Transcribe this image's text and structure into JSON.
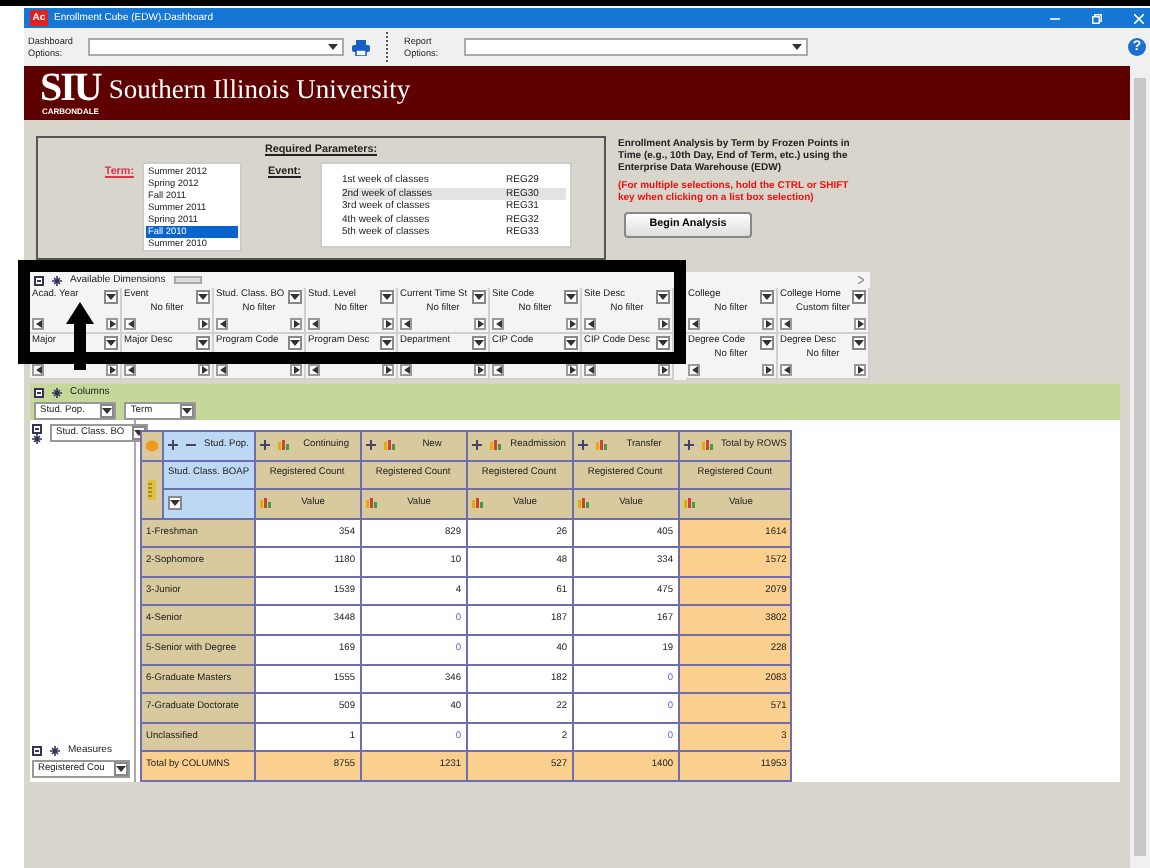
{
  "window": {
    "app_icon": "Ac",
    "title": "Enrollment Cube (EDW).Dashboard"
  },
  "toolbar": {
    "dashboard_options_label": "Dashboard Options:",
    "report_options_label": "Report Options:",
    "help": "?"
  },
  "banner": {
    "logo": "SIU",
    "campus": "CARBONDALE",
    "name": "Southern Illinois University"
  },
  "parameters": {
    "heading": "Required Parameters:",
    "term_label": "Term:",
    "terms": [
      {
        "label": "Summer 2012",
        "selected": false
      },
      {
        "label": "Spring 2012",
        "selected": false
      },
      {
        "label": "Fall 2011",
        "selected": false
      },
      {
        "label": "Summer 2011",
        "selected": false
      },
      {
        "label": "Spring 2011",
        "selected": false
      },
      {
        "label": "Fall 2010",
        "selected": true
      },
      {
        "label": "Summer 2010",
        "selected": false
      }
    ],
    "event_label": "Event:",
    "events": [
      {
        "name": "1st week of classes",
        "code": "REG29",
        "selected": false
      },
      {
        "name": "2nd week of classes",
        "code": "REG30",
        "selected": true
      },
      {
        "name": "3rd week of classes",
        "code": "REG31",
        "selected": false
      },
      {
        "name": "4th week of classes",
        "code": "REG32",
        "selected": false
      },
      {
        "name": "5th week of classes",
        "code": "REG33",
        "selected": false
      }
    ]
  },
  "description": "Enrollment Analysis by Term by Frozen Points in Time (e.g., 10th Day, End of Term, etc.) using the Enterprise Data Warehouse (EDW)",
  "hint": "(For multiple selections, hold the CTRL or SHIFT key when clicking on a list box selection)",
  "begin_button": "Begin Analysis",
  "dimensions": {
    "title": "Available Dimensions",
    "items": [
      {
        "name": "Acad. Year"
      },
      {
        "name": "Event",
        "filter": "No filter"
      },
      {
        "name": "Stud. Class. BO",
        "filter": "No filter"
      },
      {
        "name": "Stud. Level",
        "filter": "No filter"
      },
      {
        "name": "Current Time St",
        "filter": "No filter"
      },
      {
        "name": "Site Code",
        "filter": "No filter"
      },
      {
        "name": "Site Desc",
        "filter": "No filter"
      },
      {
        "name": "College",
        "filter": "No filter"
      },
      {
        "name": "College Home",
        "filter": "Custom filter"
      },
      {
        "name": "Major"
      },
      {
        "name": "Major Desc"
      },
      {
        "name": "Program Code"
      },
      {
        "name": "Program Desc"
      },
      {
        "name": "Department"
      },
      {
        "name": "CIP Code"
      },
      {
        "name": "CIP Code Desc"
      },
      {
        "name": "Degree Code",
        "filter": "No filter"
      },
      {
        "name": "Degree Desc",
        "filter": "No filter"
      }
    ]
  },
  "columns": {
    "title": "Columns",
    "fields": [
      "Stud. Pop.",
      "Term"
    ]
  },
  "rows": {
    "fields": [
      "Stud. Class. BO"
    ]
  },
  "pivot": {
    "column_field": "Stud. Pop.",
    "row_field": "Stud. Class. BOAP",
    "columns": [
      {
        "label": "Continuing",
        "measure": "Registered Count",
        "value_label": "Value"
      },
      {
        "label": "New",
        "measure": "Registered Count",
        "value_label": "Value"
      },
      {
        "label": "Readmission",
        "measure": "Registered Count",
        "value_label": "Value"
      },
      {
        "label": "Transfer",
        "measure": "Registered Count",
        "value_label": "Value"
      },
      {
        "label": "Total by ROWS",
        "measure": "Registered Count",
        "value_label": "Value"
      }
    ],
    "rows": [
      {
        "label": "1-Freshman",
        "values": [
          "354",
          "829",
          "26",
          "405",
          "1614"
        ]
      },
      {
        "label": "2-Sophomore",
        "values": [
          "1180",
          "10",
          "48",
          "334",
          "1572"
        ]
      },
      {
        "label": "3-Junior",
        "values": [
          "1539",
          "4",
          "61",
          "475",
          "2079"
        ]
      },
      {
        "label": "4-Senior",
        "values": [
          "3448",
          "0",
          "187",
          "167",
          "3802"
        ]
      },
      {
        "label": "5-Senior with Degree",
        "values": [
          "169",
          "0",
          "40",
          "19",
          "228"
        ]
      },
      {
        "label": "6-Graduate Masters",
        "values": [
          "1555",
          "346",
          "182",
          "0",
          "2083"
        ]
      },
      {
        "label": "7-Graduate Doctorate",
        "values": [
          "509",
          "40",
          "22",
          "0",
          "571"
        ]
      },
      {
        "label": "Unclassified",
        "values": [
          "1",
          "0",
          "2",
          "0",
          "3"
        ]
      }
    ],
    "total": {
      "label": "Total by COLUMNS",
      "values": [
        "8755",
        "1231",
        "527",
        "1400",
        "11953"
      ]
    }
  },
  "measures": {
    "title": "Measures",
    "fields": [
      "Registered Cou"
    ]
  }
}
